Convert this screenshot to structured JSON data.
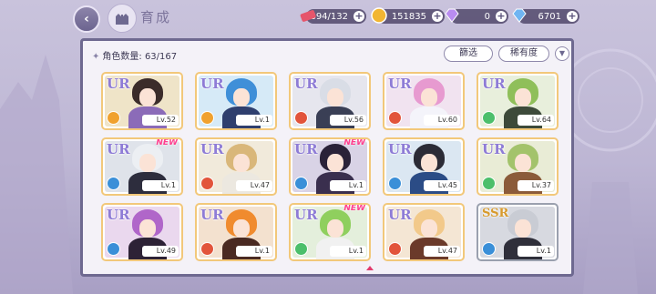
{
  "header": {
    "title": "育成",
    "resources": [
      {
        "icon": "stamina-icon",
        "value": "894/132",
        "color": "#e6556b"
      },
      {
        "icon": "gold-coin-icon",
        "value": "151835",
        "color": "#f2b632"
      },
      {
        "icon": "purple-diamond-icon",
        "value": "0",
        "color": "#b98cf0"
      },
      {
        "icon": "blue-diamond-icon",
        "value": "6701",
        "color": "#6fb5f2"
      }
    ]
  },
  "panel": {
    "count_label": "角色数量: 63/167",
    "filter_label": "篩选",
    "rarity_label": "稀有度"
  },
  "cards": [
    {
      "rarity": "UR",
      "level": "Lv.52",
      "new": "",
      "attr_color": "#f0a12e",
      "bg": "#efe4c8",
      "hair": "#3b2c2a",
      "cloth": "#8b6bb8"
    },
    {
      "rarity": "UR",
      "level": "Lv.1",
      "new": "",
      "attr_color": "#f0a12e",
      "bg": "#d6eaf7",
      "hair": "#3f8fd8",
      "cloth": "#2f3f6e"
    },
    {
      "rarity": "UR",
      "level": "Lv.56",
      "new": "",
      "attr_color": "#e2543b",
      "bg": "#e6e6ee",
      "hair": "#d9dde6",
      "cloth": "#3a3f55"
    },
    {
      "rarity": "UR",
      "level": "Lv.60",
      "new": "",
      "attr_color": "#e2543b",
      "bg": "#f1e3f0",
      "hair": "#e79ad0",
      "cloth": "#f4f4fa"
    },
    {
      "rarity": "UR",
      "level": "Lv.64",
      "new": "",
      "attr_color": "#4cbf6b",
      "bg": "#e8efdc",
      "hair": "#8fbf5a",
      "cloth": "#3d4a3a"
    },
    {
      "rarity": "UR",
      "level": "Lv.1",
      "new": "NEW",
      "attr_color": "#3a8fd8",
      "bg": "#dfe3ea",
      "hair": "#eceff3",
      "cloth": "#2d2d3d"
    },
    {
      "rarity": "UR",
      "level": "Lv.47",
      "new": "",
      "attr_color": "#e2543b",
      "bg": "#f1eadb",
      "hair": "#d9b77a",
      "cloth": "#ece8e0"
    },
    {
      "rarity": "UR",
      "level": "Lv.1",
      "new": "NEW",
      "attr_color": "#3a8fd8",
      "bg": "#d9d3e6",
      "hair": "#2a2238",
      "cloth": "#3a2f4e"
    },
    {
      "rarity": "UR",
      "level": "Lv.45",
      "new": "",
      "attr_color": "#3a8fd8",
      "bg": "#dbe7f2",
      "hair": "#2b2b36",
      "cloth": "#2b4c86"
    },
    {
      "rarity": "UR",
      "level": "Lv.37",
      "new": "",
      "attr_color": "#4cbf6b",
      "bg": "#e9ecd6",
      "hair": "#a3c36b",
      "cloth": "#8b5b3a"
    },
    {
      "rarity": "UR",
      "level": "Lv.49",
      "new": "",
      "attr_color": "#3a8fd8",
      "bg": "#ead8ee",
      "hair": "#b066c9",
      "cloth": "#2d2236"
    },
    {
      "rarity": "UR",
      "level": "Lv.1",
      "new": "",
      "attr_color": "#e2543b",
      "bg": "#f3e1cf",
      "hair": "#f08b2e",
      "cloth": "#4a2a22"
    },
    {
      "rarity": "UR",
      "level": "Lv.1",
      "new": "NEW",
      "attr_color": "#4cbf6b",
      "bg": "#e4efdc",
      "hair": "#8fcf5e",
      "cloth": "#f1f1f1"
    },
    {
      "rarity": "UR",
      "level": "Lv.47",
      "new": "",
      "attr_color": "#e2543b",
      "bg": "#f4e6d4",
      "hair": "#f2c98a",
      "cloth": "#6b3a2a"
    },
    {
      "rarity": "SSR",
      "level": "Lv.1",
      "new": "",
      "attr_color": "#3a8fd8",
      "bg": "#d7d9e0",
      "hair": "#c9ccd4",
      "cloth": "#2f2f3a"
    }
  ]
}
